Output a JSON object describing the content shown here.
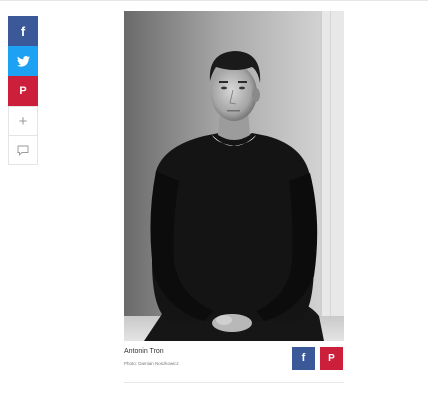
{
  "share_rail": {
    "items": [
      {
        "icon": "facebook-icon",
        "glyph": "f",
        "color": "#3b5998"
      },
      {
        "icon": "twitter-icon",
        "color": "#1da1f2"
      },
      {
        "icon": "pinterest-icon",
        "glyph": "P",
        "color": "#cb1f3c"
      },
      {
        "icon": "plus-icon",
        "glyph": "+"
      },
      {
        "icon": "comment-icon"
      }
    ]
  },
  "photo": {
    "subject": "black and white portrait"
  },
  "caption": {
    "name": "Antonin Tron",
    "credit": "Photo: Damian Noszkowicz"
  },
  "caption_share": {
    "facebook_glyph": "f",
    "pinterest_glyph": "P",
    "facebook_color": "#3b5998",
    "pinterest_color": "#cb1f3c"
  }
}
